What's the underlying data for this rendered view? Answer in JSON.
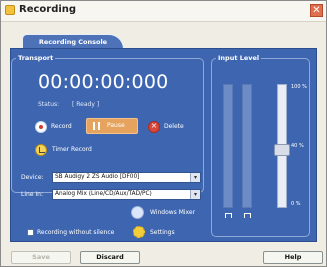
{
  "window": {
    "title": "Recording",
    "close_glyph": "✕"
  },
  "tab": {
    "label": "Recording Console"
  },
  "transport": {
    "label": "Transport",
    "time": "00:00:00:000",
    "status_label": "Status:",
    "status_value": "[ Ready ]",
    "record_label": "Record",
    "pause_label": "Pause",
    "delete_label": "Delete",
    "timer_label": "Timer Record"
  },
  "device": {
    "label": "Device:",
    "value": "SB Audigy 2 ZS Audio [DF00]"
  },
  "line_in": {
    "label": "Line In:",
    "value": "Analog Mix (Line/CD/Aux/TAD/PC)"
  },
  "windows_mixer": {
    "label": "Windows Mixer"
  },
  "recording_without_silence": {
    "label": "Recording without silence",
    "checked": false
  },
  "settings": {
    "label": "Settings"
  },
  "input_level": {
    "label": "Input Level",
    "tick_top": "100 %",
    "tick_mid": "40 %",
    "tick_bot": "0 %",
    "slider_percent": 46
  },
  "buttons": {
    "save": "Save",
    "discard": "Discard",
    "help": "Help"
  },
  "colors": {
    "panel": "#3e66b0",
    "pause": "#e6a35e",
    "record": "#d43a2f",
    "delete": "#d7473b"
  }
}
